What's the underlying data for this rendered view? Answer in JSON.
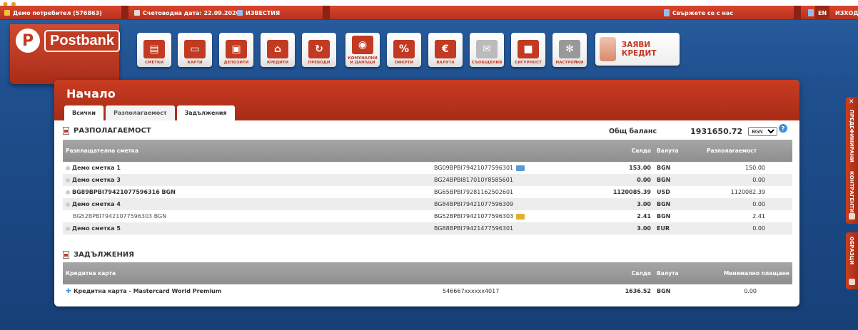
{
  "topbar": {
    "user": "Демо потребител (576863)",
    "accounting_date": "Счетоводна дата: 22.09.2020",
    "news": "ИЗВЕСТИЯ",
    "contact": "Свържете се с нас",
    "lang": "EN",
    "logout": "ИЗХОД"
  },
  "logo": {
    "name": "Postbank",
    "mark": "P"
  },
  "nav": [
    {
      "label": "СМЕТКИ",
      "icon": "folder-icon",
      "color": "#c23a22"
    },
    {
      "label": "КАРТИ",
      "icon": "card-icon",
      "color": "#c23a22"
    },
    {
      "label": "ДЕПОЗИТИ",
      "icon": "safe-icon",
      "color": "#c23a22"
    },
    {
      "label": "КРЕДИТИ",
      "icon": "house-icon",
      "color": "#c23a22"
    },
    {
      "label": "ПРЕВОДИ",
      "icon": "transfer-icon",
      "color": "#c23a22"
    },
    {
      "label": "КОМУНАЛНИ И ДАНЪЦИ",
      "icon": "bulb-icon",
      "color": "#c23a22"
    },
    {
      "label": "ОФЕРТИ",
      "icon": "percent-icon",
      "color": "#c23a22"
    },
    {
      "label": "ВАЛУТА",
      "icon": "euro-icon",
      "color": "#c23a22"
    },
    {
      "label": "СЪОБЩЕНИЯ",
      "icon": "envelope-icon",
      "color": "#bbbbbb"
    },
    {
      "label": "СИГУРНОСТ",
      "icon": "lock-icon",
      "color": "#c23a22"
    },
    {
      "label": "НАСТРОЙКИ",
      "icon": "gear-icon",
      "color": "#999999"
    }
  ],
  "apply_credit": "ЗАЯВИ КРЕДИТ",
  "page": {
    "title": "Начало",
    "tabs": [
      "Всички",
      "Разполагаемост",
      "Задължения"
    ]
  },
  "availability": {
    "heading": "РАЗПОЛАГАЕМОСТ",
    "total_label": "Общ баланс",
    "total_value": "1931650.72",
    "currency_select": "BGN",
    "columns": [
      "Разплащателна сметка",
      "",
      "Салдо",
      "Валута",
      "Разполагаемост"
    ],
    "rows": [
      {
        "name": "Демо сметка 1",
        "iban": "BG09BPBI79421077596301",
        "balance": "153.00",
        "currency": "BGN",
        "available": "150.00"
      },
      {
        "name": "Демо сметка 3",
        "iban": "BG24BPBI817010Y8585601",
        "balance": "0.00",
        "currency": "BGN",
        "available": "0.00"
      },
      {
        "name": "BG89BPBI79421077596316 BGN",
        "iban": "BG65BPBI79281162502601",
        "balance": "1120085.39",
        "currency": "USD",
        "available": "1120082.39"
      },
      {
        "name": "Демо сметка 4",
        "iban": "BG84BPBI79421077596309",
        "balance": "3.00",
        "currency": "BGN",
        "available": "0.00"
      },
      {
        "name": "BG52BPBI79421077596303 BGN",
        "iban": "BG52BPBI79421077596303",
        "balance": "2.41",
        "currency": "BGN",
        "available": "2.41"
      },
      {
        "name": "Демо сметка 5",
        "iban": "BG88BPBI79421477596301",
        "balance": "3.00",
        "currency": "EUR",
        "available": "0.00"
      }
    ]
  },
  "liabilities": {
    "heading": "ЗАДЪЛЖЕНИЯ",
    "columns": [
      "Кредитна карта",
      "",
      "Салдо",
      "Валута",
      "Минимално плащане"
    ],
    "rows": [
      {
        "name": "Кредитна карта - Mastercard World Premium",
        "number": "546667xxxxxx4017",
        "balance": "1636.52",
        "currency": "BGN",
        "min_payment": "0.00"
      }
    ]
  },
  "side_panels": [
    "ПРЕДЕФИНИРАНИ",
    "КОНТРАГЕНТИ",
    "ОБРАЗЦИ"
  ],
  "help": "?"
}
